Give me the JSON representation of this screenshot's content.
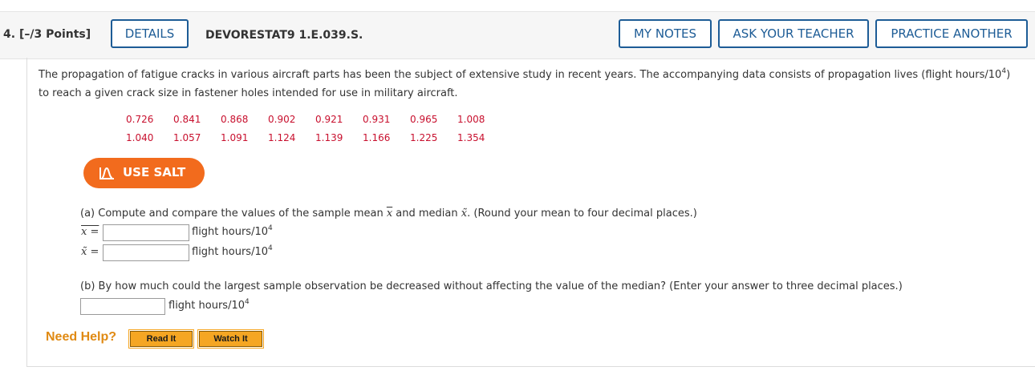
{
  "header": {
    "question_number": "4.",
    "points": "[–/3 Points]",
    "details_label": "DETAILS",
    "question_code": "DEVORESTAT9 1.E.039.S.",
    "my_notes_label": "MY NOTES",
    "ask_teacher_label": "ASK YOUR TEACHER",
    "practice_another_label": "PRACTICE ANOTHER"
  },
  "intro": {
    "line1_pre": "The propagation of fatigue cracks in various aircraft parts has been the subject of extensive study in recent years. The accompanying data consists of propagation lives (flight hours/10",
    "line1_exp": "4",
    "line1_post": ")",
    "line2": "to reach a given crack size in fastener holes intended for use in military aircraft."
  },
  "data_values": {
    "row1": [
      "0.726",
      "0.841",
      "0.868",
      "0.902",
      "0.921",
      "0.931",
      "0.965",
      "1.008"
    ],
    "row2": [
      "1.040",
      "1.057",
      "1.091",
      "1.124",
      "1.139",
      "1.166",
      "1.225",
      "1.354"
    ]
  },
  "salt": {
    "label": "USE SALT",
    "icon": "salt-chart-icon"
  },
  "part_a": {
    "prompt_pre": "(a) Compute and compare the values of the sample mean ",
    "mean_symbol": "x",
    "prompt_mid": " and median ",
    "median_symbol": "x̃",
    "prompt_post": ". (Round your mean to four decimal places.)",
    "mean_label": "x =",
    "median_label": "x̃ =",
    "mean_value": "",
    "median_value": "",
    "unit": "flight hours/10",
    "unit_exp": "4"
  },
  "part_b": {
    "prompt": "(b) By how much could the largest sample observation be decreased without affecting the value of the median? (Enter your answer to three decimal places.)",
    "value": "",
    "unit": "flight hours/10",
    "unit_exp": "4"
  },
  "help": {
    "label": "Need Help?",
    "read_it": "Read It",
    "watch_it": "Watch It"
  },
  "colors": {
    "accent_blue": "#1d5c96",
    "data_red": "#c8102e",
    "salt_orange": "#f26b1d",
    "help_orange": "#e08a13",
    "help_button": "#f5a623"
  }
}
